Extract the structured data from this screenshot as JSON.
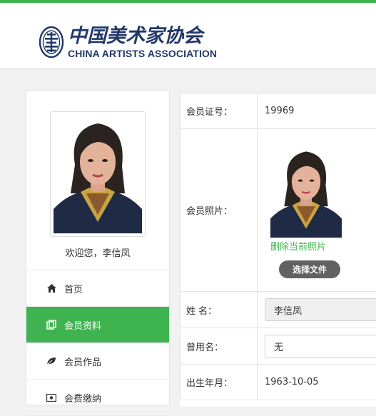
{
  "brand": {
    "name_cn": "中国美术家协会",
    "name_en": "CHINA ARTISTS ASSOCIATION",
    "accent_color": "#3fb34f",
    "logo_color": "#22386a"
  },
  "sidebar": {
    "welcome": "欢迎您，李信凤",
    "items": [
      {
        "label": "首页",
        "icon": "home-icon",
        "active": false
      },
      {
        "label": "会员资料",
        "icon": "profile-card-icon",
        "active": true
      },
      {
        "label": "会员作品",
        "icon": "leaf-icon",
        "active": false
      },
      {
        "label": "会费缴纳",
        "icon": "money-icon",
        "active": false
      }
    ]
  },
  "profile": {
    "member_id_label": "会员证号：",
    "member_id": "19969",
    "photo_label": "会员照片：",
    "delete_photo": "删除当前照片",
    "choose_file": "选择文件",
    "name_label": "姓 名：",
    "name_value": "李信凤",
    "alias_label": "曾用名：",
    "alias_value": "无",
    "birth_label": "出生年月：",
    "birth_value": "1963-10-05"
  }
}
